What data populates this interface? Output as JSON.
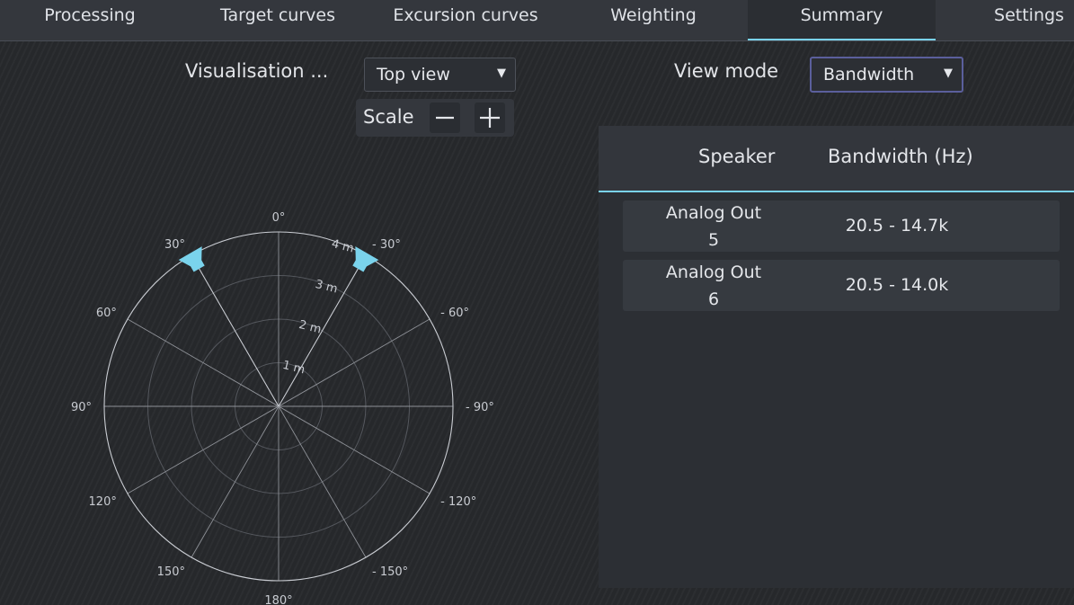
{
  "tabs": [
    {
      "label": "Processing",
      "active": false
    },
    {
      "label": "Target curves",
      "active": false
    },
    {
      "label": "Excursion curves",
      "active": false
    },
    {
      "label": "Weighting",
      "active": false
    },
    {
      "label": "Summary",
      "active": true
    },
    {
      "label": "Settings",
      "active": false
    }
  ],
  "visualisation": {
    "label": "Visualisation ...",
    "selected": "Top view"
  },
  "view_mode": {
    "label": "View mode",
    "selected": "Bandwidth"
  },
  "scale": {
    "label": "Scale"
  },
  "polar": {
    "angle_labels": {
      "a0": "0°",
      "l30": "30°",
      "r30": "- 30°",
      "l60": "60°",
      "r60": "- 60°",
      "l90": "90°",
      "r90": "- 90°",
      "l120": "120°",
      "r120": "- 120°",
      "l150": "150°",
      "r150": "- 150°",
      "a180": "180°"
    },
    "distance_labels": [
      "1 m",
      "2 m",
      "3 m",
      "4 m"
    ],
    "max_distance_m": 4,
    "speakers": [
      {
        "angle_deg": 30,
        "distance_m": 3.85
      },
      {
        "angle_deg": -30,
        "distance_m": 3.85
      }
    ],
    "speaker_color": "#7ad3ec"
  },
  "table": {
    "headers": {
      "speaker": "Speaker",
      "bandwidth": "Bandwidth (Hz)"
    },
    "rows": [
      {
        "speaker": "Analog Out 5",
        "bandwidth": "20.5 - 14.7k"
      },
      {
        "speaker": "Analog Out 6",
        "bandwidth": "20.5 - 14.0k"
      }
    ]
  },
  "colors": {
    "accent": "#7ad3ec",
    "focus_border": "#5b5f9c"
  }
}
